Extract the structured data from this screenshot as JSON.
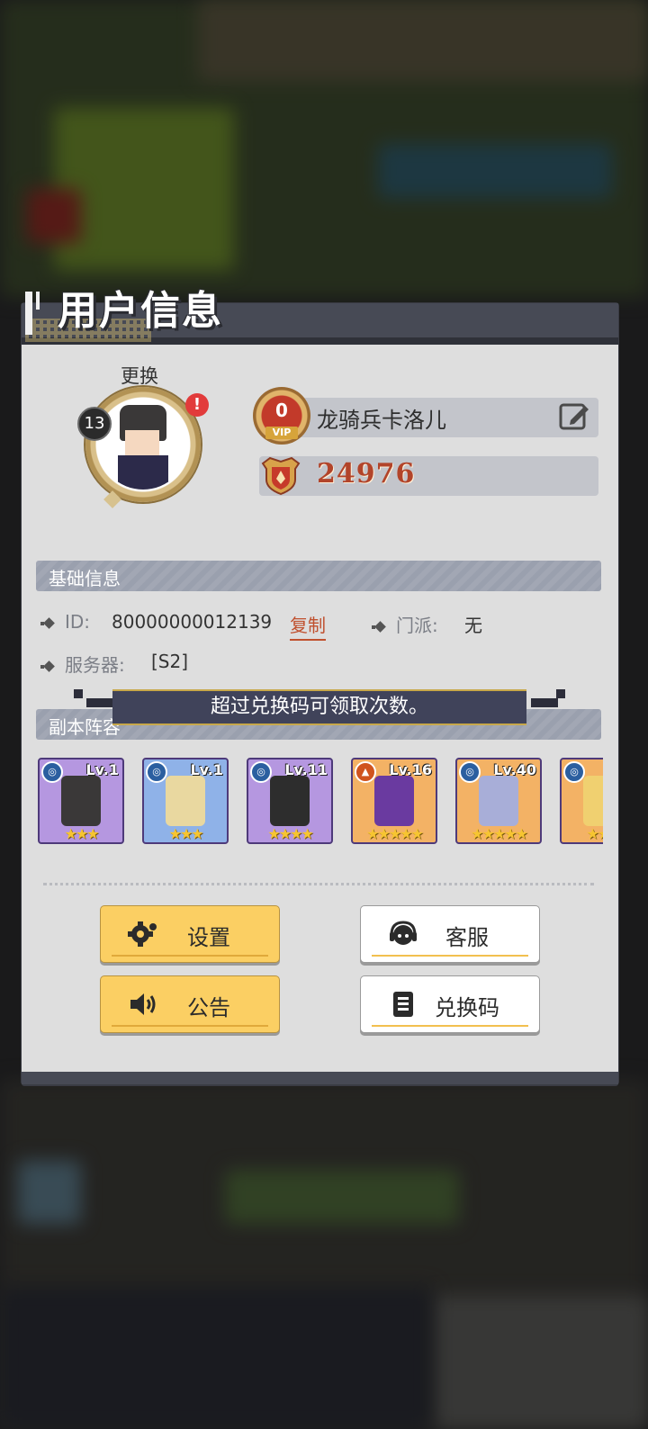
{
  "panel": {
    "title": "用户信息"
  },
  "profile": {
    "change_label": "更换",
    "level": "13",
    "alert": "!",
    "vip_level": "0",
    "vip_label": "VIP",
    "name": "龙骑兵卡洛儿",
    "power": "24976"
  },
  "basic_info": {
    "header": "基础信息",
    "id_label": "ID:",
    "id_value": "80000000012139",
    "copy_label": "复制",
    "faction_label": "门派:",
    "faction_value": "无",
    "server_label": "服务器:",
    "server_value": "[S2]"
  },
  "toast": {
    "message": "超过兑换码可领取次数。"
  },
  "lineup": {
    "header": "副本阵容",
    "heroes": [
      {
        "level": "Lv.1",
        "element": "water-icon",
        "stars": "★★★",
        "bg": "#b597e0",
        "sprite": "#3a3838"
      },
      {
        "level": "Lv.1",
        "element": "water-icon",
        "stars": "★★★",
        "bg": "#8fb2e8",
        "sprite": "#e9d8a0"
      },
      {
        "level": "Lv.11",
        "element": "water-icon",
        "stars": "★★★★",
        "bg": "#b597e0",
        "sprite": "#2d2d2d"
      },
      {
        "level": "Lv.16",
        "element": "fire-icon",
        "stars": "★★★★★",
        "bg": "#f3b265",
        "sprite": "#6a3aa0"
      },
      {
        "level": "Lv.40",
        "element": "water-icon",
        "stars": "★★★★★",
        "bg": "#f3b265",
        "sprite": "#a8aed8"
      },
      {
        "level": "",
        "element": "water-icon",
        "stars": "★★★",
        "bg": "#f3b265",
        "sprite": "#f0d070"
      }
    ]
  },
  "buttons": {
    "settings": "设置",
    "support": "客服",
    "notice": "公告",
    "redeem": "兑换码"
  },
  "colors": {
    "accent_yellow": "#fbcf63",
    "power_red": "#b2442a",
    "section_bg": "#9aa0ae"
  }
}
